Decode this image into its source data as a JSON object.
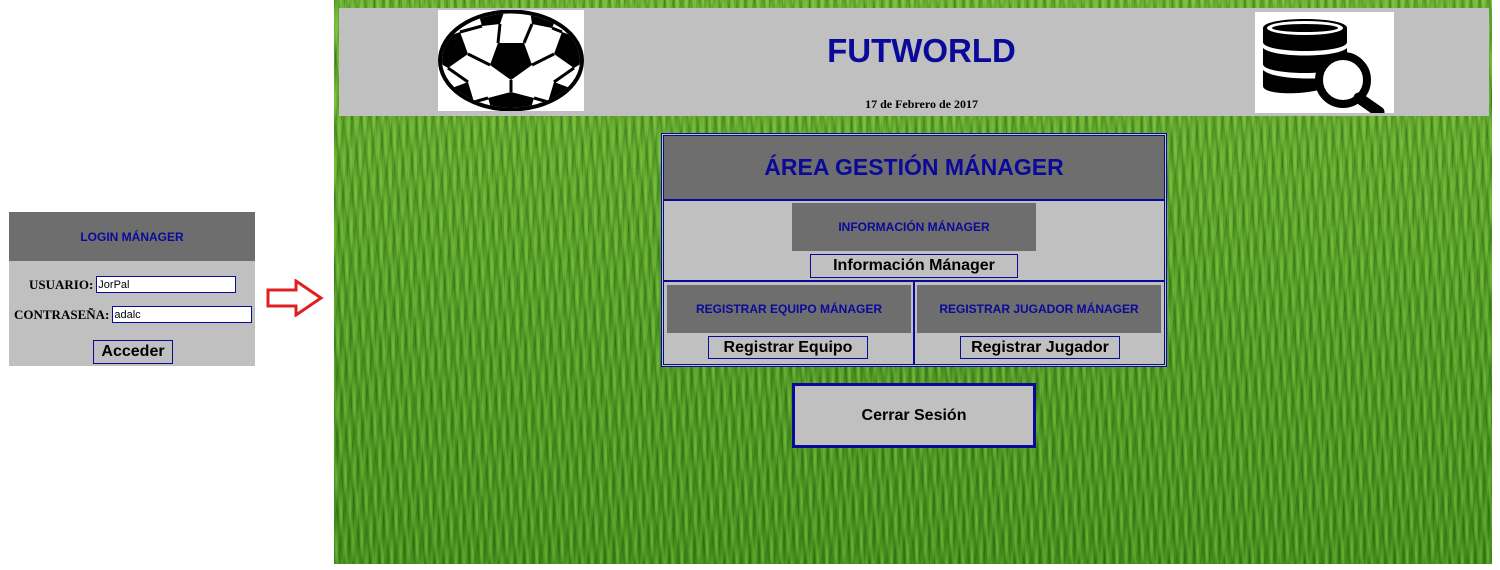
{
  "login": {
    "title": "LOGIN MÁNAGER",
    "user_label": "USUARIO:",
    "user_value": "JorPal",
    "password_label": "CONTRASEÑA:",
    "password_value": "adalc",
    "submit_label": "Acceder"
  },
  "site": {
    "title": "FUTWORLD",
    "date": "17 de Febrero de 2017"
  },
  "gestion": {
    "title": "ÁREA GESTIÓN MÁNAGER",
    "info": {
      "label": "INFORMACIÓN MÁNAGER",
      "button": "Información Mánager"
    },
    "equipo": {
      "label": "REGISTRAR EQUIPO MÁNAGER",
      "button": "Registrar Equipo"
    },
    "jugador": {
      "label": "REGISTRAR JUGADOR MÁNAGER",
      "button": "Registrar Jugador"
    }
  },
  "logout_label": "Cerrar Sesión",
  "colors": {
    "accent": "#0a0a9a",
    "panel": "#c0c0c0",
    "header": "#6e6e6e",
    "arrow": "#e02020",
    "grass": "#5ea82a"
  },
  "icons": {
    "arrow": "right-arrow-icon",
    "logo": "soccer-ball-icon",
    "database": "database-search-icon"
  }
}
